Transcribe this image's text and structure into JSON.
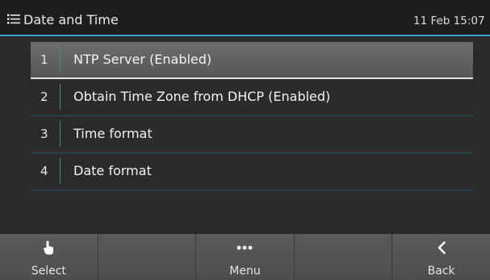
{
  "header": {
    "title": "Date and Time",
    "datetime": "11 Feb 15:07",
    "menu_icon": "list-menu-icon",
    "accent_color": "#3aa7c9"
  },
  "menu": {
    "selected_index": 0,
    "items": [
      {
        "number": "1",
        "label": "NTP Server (Enabled)"
      },
      {
        "number": "2",
        "label": "Obtain Time Zone from DHCP (Enabled)"
      },
      {
        "number": "3",
        "label": "Time format"
      },
      {
        "number": "4",
        "label": "Date format"
      }
    ]
  },
  "softkeys": [
    {
      "label": "Select",
      "icon": "hand-pointer-icon"
    },
    {
      "label": "",
      "icon": ""
    },
    {
      "label": "Menu",
      "icon": "more-dots-icon"
    },
    {
      "label": "",
      "icon": ""
    },
    {
      "label": "Back",
      "icon": "chevron-left-icon"
    }
  ]
}
